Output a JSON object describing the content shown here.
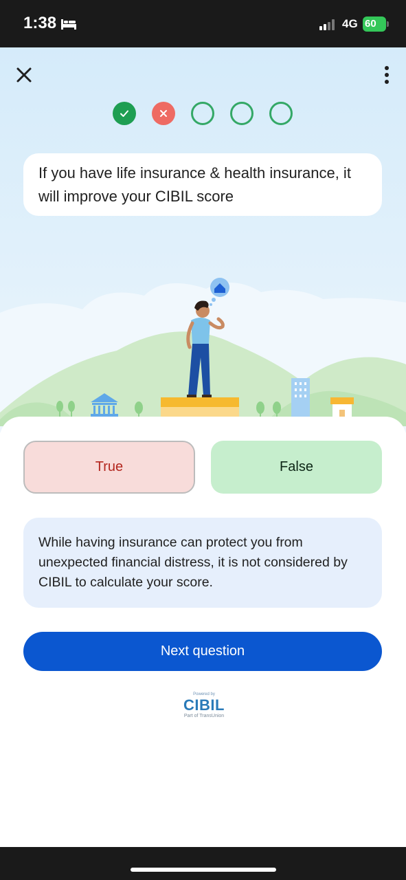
{
  "status_bar": {
    "time": "1:38",
    "network": "4G",
    "battery": "60"
  },
  "toolbar": {
    "close_icon": "close-icon",
    "more_icon": "more-vertical-icon"
  },
  "progress": {
    "states": [
      "correct",
      "wrong",
      "pending",
      "pending",
      "pending"
    ]
  },
  "question": {
    "text": "If you have life insurance & health insurance, it will improve your CIBIL score"
  },
  "answers": {
    "true_label": "True",
    "false_label": "False",
    "selected": "True"
  },
  "explanation": {
    "text": "While having insurance can protect you from unexpected financial distress, it is not considered by CIBIL to calculate your score."
  },
  "next_button": {
    "label": "Next question"
  },
  "branding": {
    "powered_by": "Powered by",
    "name": "CIBIL",
    "subtitle": "Part of TransUnion"
  },
  "colors": {
    "accent": "#0b57d0",
    "correct": "#1e9e52",
    "wrong": "#ee6b63",
    "true_bg": "#f8dcda",
    "false_bg": "#c6eecd"
  }
}
